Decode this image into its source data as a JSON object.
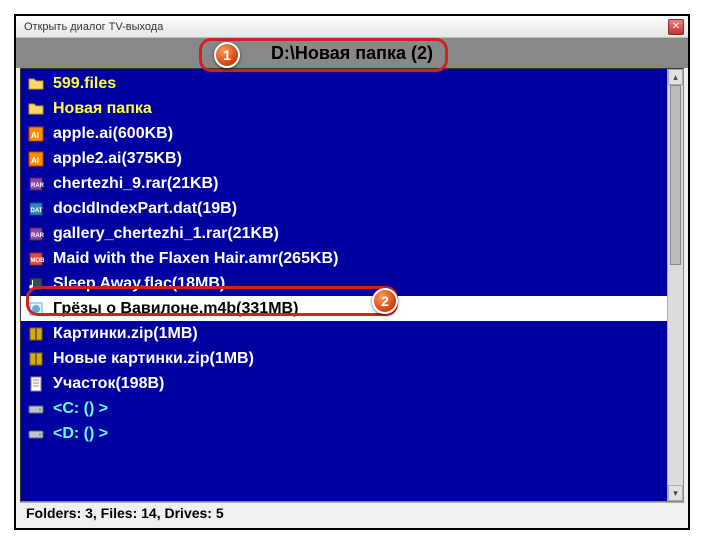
{
  "window": {
    "title": "Открыть диалог TV-выхода"
  },
  "path": "D:\\Новая папка (2)",
  "callouts": {
    "one": "1",
    "two": "2"
  },
  "items": [
    {
      "name": "599.files",
      "kind": "folder"
    },
    {
      "name": "Новая папка",
      "kind": "folder"
    },
    {
      "name": "apple.ai(600KB)",
      "kind": "ai"
    },
    {
      "name": "apple2.ai(375KB)",
      "kind": "ai"
    },
    {
      "name": "chertezhi_9.rar(21KB)",
      "kind": "rar"
    },
    {
      "name": "docIdIndexPart.dat(19B)",
      "kind": "dat"
    },
    {
      "name": "gallery_chertezhi_1.rar(21KB)",
      "kind": "rar"
    },
    {
      "name": "Maid with the Flaxen Hair.amr(265KB)",
      "kind": "amr"
    },
    {
      "name": "Sleep Away.flac(18MB)",
      "kind": "flac"
    },
    {
      "name": "Грёзы о Вавилоне.m4b(331MB)",
      "kind": "m4b",
      "selected": true
    },
    {
      "name": "Картинки.zip(1MB)",
      "kind": "zip"
    },
    {
      "name": "Новые картинки.zip(1MB)",
      "kind": "zip"
    },
    {
      "name": "Участок(198B)",
      "kind": "generic"
    },
    {
      "name": "<C: () >",
      "kind": "drive"
    },
    {
      "name": "<D: () >",
      "kind": "drive"
    }
  ],
  "status": "Folders: 3, Files: 14, Drives: 5"
}
